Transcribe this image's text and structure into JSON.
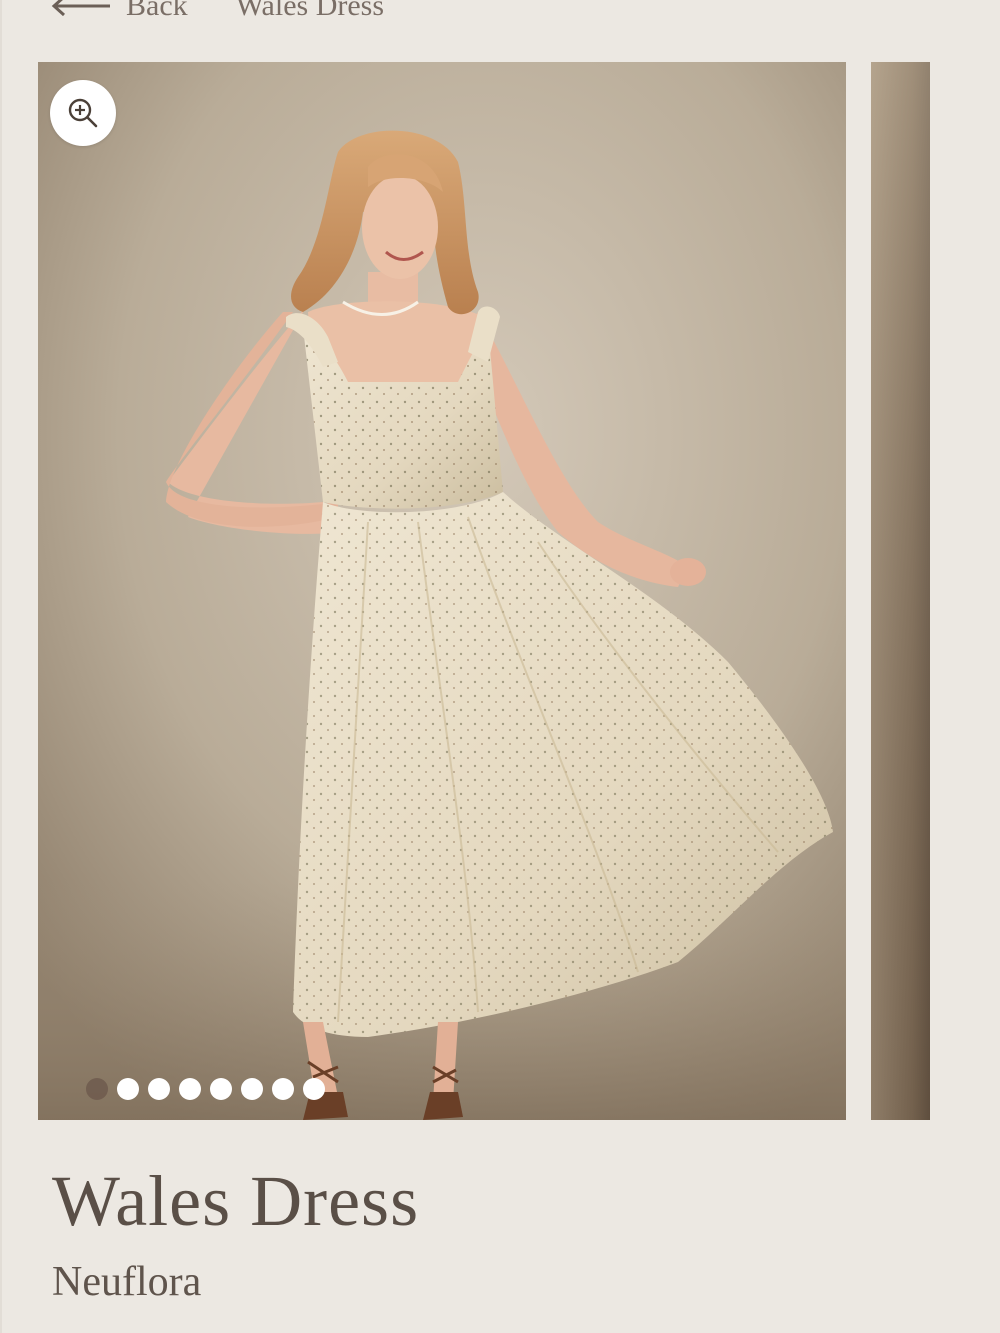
{
  "nav": {
    "back_label": "Back",
    "breadcrumb_current": "Wales Dress"
  },
  "gallery": {
    "slide_count": 8,
    "active_index": 0,
    "image_alt": "Model wearing Wales Dress"
  },
  "product": {
    "title": "Wales Dress",
    "vendor": "Neuflora"
  },
  "icons": {
    "back": "arrow-left-icon",
    "zoom": "zoom-in-icon"
  },
  "colors": {
    "page_background": "#ece8e2",
    "text": "#5a4f47",
    "dot_active": "#6e5a4e",
    "dot_inactive": "#ffffff"
  }
}
